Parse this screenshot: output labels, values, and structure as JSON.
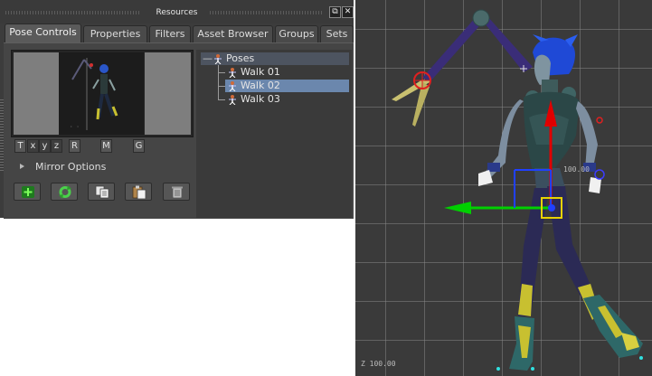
{
  "panel": {
    "title": "Resources",
    "window_buttons": [
      "⧉",
      "✕"
    ]
  },
  "tabs": [
    {
      "label": "Pose Controls",
      "active": true
    },
    {
      "label": "Properties",
      "active": false
    },
    {
      "label": "Filters",
      "active": false
    },
    {
      "label": "Asset Browser",
      "active": false
    },
    {
      "label": "Groups",
      "active": false
    },
    {
      "label": "Sets",
      "active": false
    }
  ],
  "axis_buttons": [
    {
      "label": "T"
    },
    {
      "label": "x"
    },
    {
      "label": "y"
    },
    {
      "label": "z"
    },
    {
      "label": "R"
    },
    {
      "label": "M"
    },
    {
      "label": "G"
    }
  ],
  "mirror": {
    "label": "Mirror Options"
  },
  "actions": [
    {
      "name": "add-pose-button",
      "icon": "plus-icon"
    },
    {
      "name": "refresh-pose-button",
      "icon": "refresh-icon"
    },
    {
      "name": "copy-pose-button",
      "icon": "copy-icon"
    },
    {
      "name": "paste-pose-button",
      "icon": "paste-icon"
    },
    {
      "name": "delete-pose-button",
      "icon": "trash-icon"
    }
  ],
  "tree": {
    "collapse_symbol": "—",
    "root": "Poses",
    "items": [
      {
        "label": "Walk 01",
        "selected": false
      },
      {
        "label": "Walk 02",
        "selected": true
      },
      {
        "label": "Walk 03",
        "selected": false
      }
    ]
  },
  "viewport": {
    "readout_center": "100.00",
    "readout_corner": "Z 100.00"
  },
  "colors": {
    "accent_selected": "#6b87ad",
    "gizmo_x": "#00d000",
    "gizmo_y": "#e00000",
    "gizmo_z": "#2040ff",
    "gizmo_center": "#e8d200"
  }
}
